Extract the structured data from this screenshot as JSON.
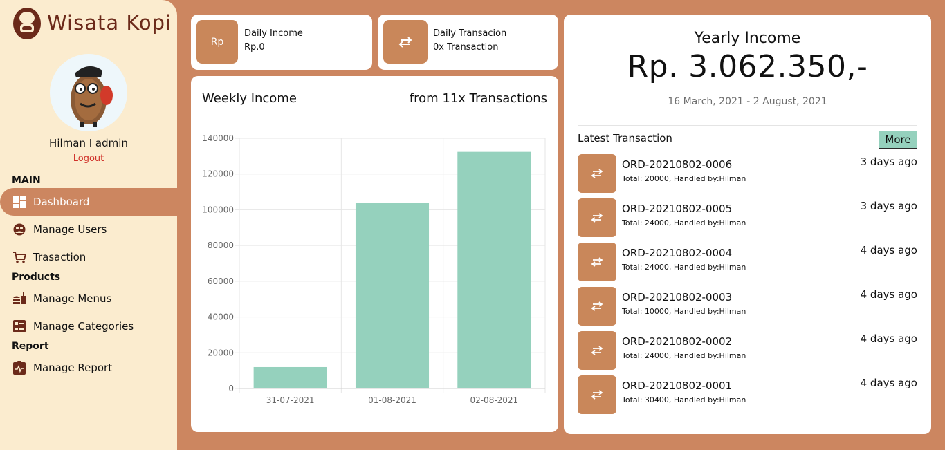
{
  "brand": {
    "name": "Wisata Kopi"
  },
  "user": {
    "name": "Hilman I admin",
    "logout_label": "Logout"
  },
  "sidebar": {
    "sections": [
      {
        "title": "MAIN"
      },
      {
        "title": "Products"
      },
      {
        "title": "Report"
      }
    ],
    "items": [
      {
        "label": "Dashboard",
        "icon": "dashboard-icon",
        "active": true
      },
      {
        "label": "Manage Users",
        "icon": "users-icon"
      },
      {
        "label": "Trasaction",
        "icon": "cart-icon"
      },
      {
        "label": "Manage Menus",
        "icon": "menu-icon"
      },
      {
        "label": "Manage Categories",
        "icon": "categories-icon"
      },
      {
        "label": "Manage Report",
        "icon": "report-icon"
      }
    ]
  },
  "stats": {
    "daily_income": {
      "icon_text": "Rp",
      "label": "Daily Income",
      "value": "Rp.0"
    },
    "daily_transaction": {
      "icon": "swap-icon",
      "label": "Daily Transacion",
      "value": "0x Transaction"
    }
  },
  "weekly": {
    "title": "Weekly Income",
    "subtitle": "from 11x Transactions"
  },
  "chart_data": {
    "type": "bar",
    "categories": [
      "31-07-2021",
      "01-08-2021",
      "02-08-2021"
    ],
    "values": [
      12000,
      104000,
      132400
    ],
    "ylim": [
      0,
      140000
    ],
    "yticks": [
      0,
      20000,
      40000,
      60000,
      80000,
      100000,
      120000,
      140000
    ],
    "grid": true,
    "bar_color": "#95d1bd",
    "title": "",
    "xlabel": "",
    "ylabel": ""
  },
  "yearly": {
    "title": "Yearly Income",
    "amount": "Rp. 3.062.350,-",
    "range": "16 March, 2021 - 2 August, 2021"
  },
  "latest": {
    "title": "Latest Transaction",
    "more_label": "More",
    "items": [
      {
        "id": "ORD-20210802-0006",
        "detail": "Total: 20000, Handled by:Hilman",
        "time": "3 days ago"
      },
      {
        "id": "ORD-20210802-0005",
        "detail": "Total: 24000, Handled by:Hilman",
        "time": "3 days ago"
      },
      {
        "id": "ORD-20210802-0004",
        "detail": "Total: 24000, Handled by:Hilman",
        "time": "4 days ago"
      },
      {
        "id": "ORD-20210802-0003",
        "detail": "Total: 10000, Handled by:Hilman",
        "time": "4 days ago"
      },
      {
        "id": "ORD-20210802-0002",
        "detail": "Total: 24000, Handled by:Hilman",
        "time": "4 days ago"
      },
      {
        "id": "ORD-20210802-0001",
        "detail": "Total: 30400, Handled by:Hilman",
        "time": "4 days ago"
      }
    ]
  },
  "colors": {
    "accent": "#cc8660",
    "sidebar_bg": "#fbeccf",
    "tile": "#c9875a",
    "bar": "#95d1bd",
    "logout": "#d0322a"
  }
}
